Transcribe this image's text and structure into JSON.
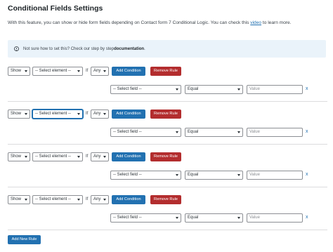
{
  "page": {
    "title": "Conditional Fields Settings",
    "desc_before": "With this feature, you can show or hide form fields depending on Contact form 7 Conditional Logic. You can check this ",
    "desc_link": "video",
    "desc_after": " to learn more."
  },
  "notice": {
    "text_before": "Not sure how to set this? Check our step by step ",
    "link": "documentation",
    "text_after": "."
  },
  "rules": [
    {
      "action": "Show",
      "element": "-- Select element --",
      "if_label": "If",
      "match": "Any",
      "add_condition": "Add Condition",
      "remove_rule": "Remove Rule",
      "condition": {
        "field": "-- Select field --",
        "operator": "Equal",
        "value_placeholder": "Value",
        "remove": "x"
      }
    },
    {
      "action": "Show",
      "element": "-- Select element --",
      "if_label": "If",
      "match": "Any",
      "add_condition": "Add Condition",
      "remove_rule": "Remove Rule",
      "condition": {
        "field": "-- Select field --",
        "operator": "Equal",
        "value_placeholder": "Value",
        "remove": "x"
      }
    },
    {
      "action": "Show",
      "element": "-- Select element --",
      "if_label": "If",
      "match": "Any",
      "add_condition": "Add Condition",
      "remove_rule": "Remove Rule",
      "condition": {
        "field": "-- Select field --",
        "operator": "Equal",
        "value_placeholder": "Value",
        "remove": "x"
      }
    },
    {
      "action": "Show",
      "element": "-- Select element --",
      "if_label": "If",
      "match": "Any",
      "add_condition": "Add Condition",
      "remove_rule": "Remove Rule",
      "condition": {
        "field": "-- Select field --",
        "operator": "Equal",
        "value_placeholder": "Value",
        "remove": "x"
      }
    }
  ],
  "add_new_rule": "Add New Rule",
  "colors": {
    "primary": "#2271b1",
    "danger": "#b32d2e",
    "notice_bg": "#eaf3fa"
  }
}
